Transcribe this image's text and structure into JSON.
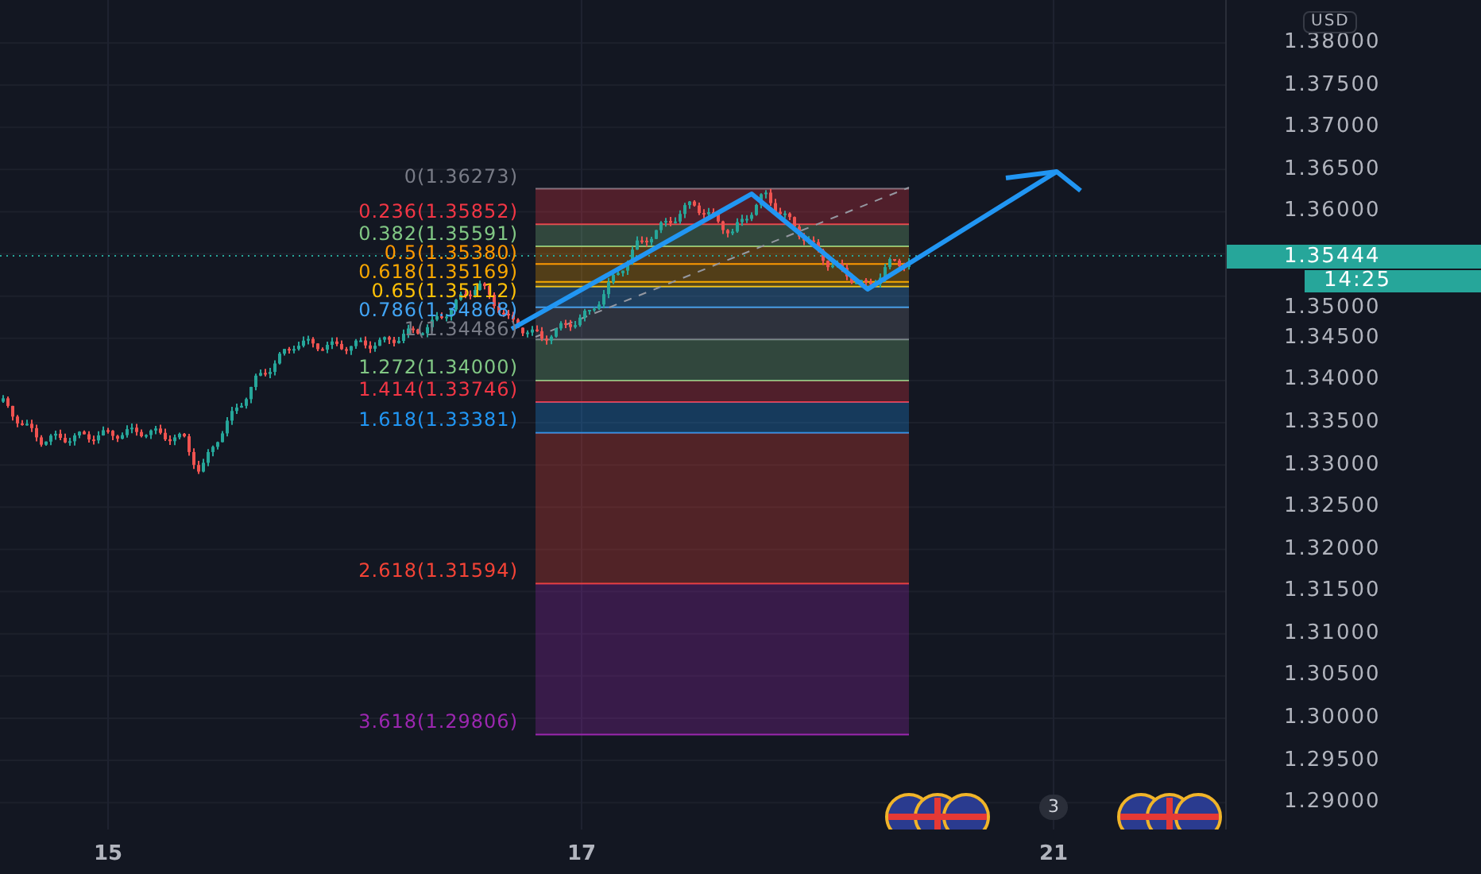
{
  "chart": {
    "fib_levels": [
      {
        "label": "0(1.36273)",
        "color": "#787b86"
      },
      {
        "label": "0.236(1.35852)",
        "color": "#f23645"
      },
      {
        "label": "0.382(1.35591)",
        "color": "#81c784"
      },
      {
        "label": "0.5(1.35380)",
        "color": "#ff9800"
      },
      {
        "label": "0.618(1.35169)",
        "color": "#f7a600"
      },
      {
        "label": "0.65(1.35112)",
        "color": "#ffc107"
      },
      {
        "label": "0.786(1.34868)",
        "color": "#42a5f5"
      },
      {
        "label": "1(1.34486)",
        "color": "#787b86"
      },
      {
        "label": "1.272(1.34000)",
        "color": "#81c784"
      },
      {
        "label": "1.414(1.33746)",
        "color": "#f23645"
      },
      {
        "label": "1.618(1.33381)",
        "color": "#2196f3"
      },
      {
        "label": "2.618(1.31594)",
        "color": "#f44336"
      },
      {
        "label": "3.618(1.29806)",
        "color": "#9c27b0"
      }
    ],
    "event_count": "3"
  },
  "price_axis": {
    "currency": "USD",
    "labels": [
      "1.38000",
      "1.37500",
      "1.37000",
      "1.36500",
      "1.36000",
      "1.35000",
      "1.34500",
      "1.34000",
      "1.33500",
      "1.33000",
      "1.32500",
      "1.32000",
      "1.31500",
      "1.31000",
      "1.30500",
      "1.30000",
      "1.29500",
      "1.29000"
    ],
    "current_price": "1.35444",
    "countdown": "14:25"
  },
  "time_axis": {
    "labels": [
      "15",
      "17",
      "21"
    ]
  }
}
